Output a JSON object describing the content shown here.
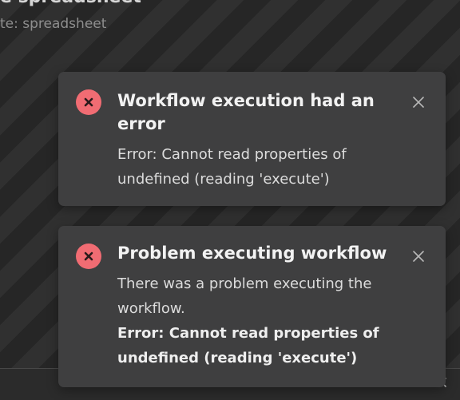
{
  "background": {
    "title": "e spreadsheet",
    "subtitle": "te: spreadsheet"
  },
  "colors": {
    "toast_background": "#3f3f40",
    "error_icon": "#f16c73",
    "text": "#e8e8e8"
  },
  "toasts": [
    {
      "icon": "error-x-icon",
      "title": "Workflow execution had an error",
      "message": "Error: Cannot read properties of undefined (reading 'execute')",
      "close_icon": "close-icon"
    },
    {
      "icon": "error-x-icon",
      "title": "Problem executing workflow",
      "message": "There was a problem executing the workflow.",
      "error_detail": "Error: Cannot read properties of undefined (reading 'execute')",
      "close_icon": "close-icon"
    }
  ]
}
